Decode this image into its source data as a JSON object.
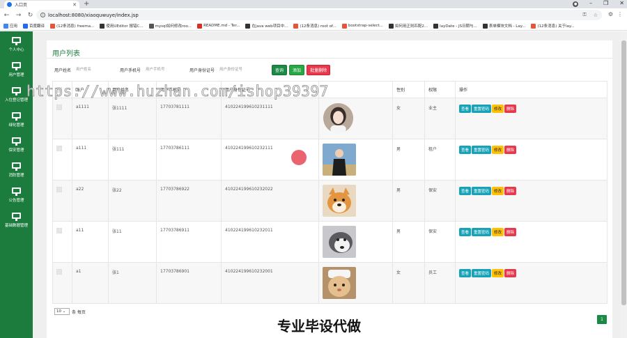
{
  "browser": {
    "tab_title": "入口页",
    "url": "localhost:8080/xiaoquwuye/index.jsp",
    "bookmarks": [
      {
        "label": "应用",
        "color": "#4285f4"
      },
      {
        "label": "百度翻译",
        "color": "#2468f2"
      },
      {
        "label": "(12条消息) freema...",
        "color": "#e8543a"
      },
      {
        "label": "使用UEditor 报错C...",
        "color": "#333333"
      },
      {
        "label": "mysql如何修改roo...",
        "color": "#555555"
      },
      {
        "label": "README.md - Ter...",
        "color": "#d93025"
      },
      {
        "label": "在java web项目中...",
        "color": "#333333"
      },
      {
        "label": "(12条消息) root of...",
        "color": "#e8543a"
      },
      {
        "label": "bootstrap-select...",
        "color": "#e8543a"
      },
      {
        "label": "如何用正则匹配2...",
        "color": "#333333"
      },
      {
        "label": "layDate - JS日期与...",
        "color": "#333333"
      },
      {
        "label": "表单模块文档 - Lay...",
        "color": "#333333"
      },
      {
        "label": "(12条消息) 关于lay...",
        "color": "#e8543a"
      }
    ]
  },
  "sidebar": {
    "items": [
      {
        "label": "个人中心"
      },
      {
        "label": "用户管理"
      },
      {
        "label": "入住登记管理"
      },
      {
        "label": "绿化管理"
      },
      {
        "label": "保安管理"
      },
      {
        "label": "消防管理"
      },
      {
        "label": "公告管理"
      },
      {
        "label": "基础数据管理"
      }
    ]
  },
  "page": {
    "title": "用户列表",
    "search": {
      "name_label": "用户姓名",
      "name_placeholder": "用户姓名",
      "phone_label": "用户手机号",
      "phone_placeholder": "用户手机号",
      "id_label": "用户身份证号",
      "id_placeholder": "用户身份证号",
      "btn_query": "查询",
      "btn_add": "添加",
      "btn_batch_delete": "批量删除"
    },
    "table": {
      "columns": [
        "",
        "账户",
        "用户姓名",
        "用户手机号",
        "用户身份证号",
        "",
        "性别",
        "权限",
        "操作"
      ],
      "rows": [
        {
          "account": "a1111",
          "name": "张1111",
          "phone": "17703781111",
          "idcard": "410224199610231111",
          "gender": "女",
          "role": "业主",
          "avatar": "girl"
        },
        {
          "account": "a111",
          "name": "张111",
          "phone": "17703786111",
          "idcard": "410224199610232111",
          "gender": "男",
          "role": "租户",
          "avatar": "boy"
        },
        {
          "account": "a22",
          "name": "张22",
          "phone": "17703786922",
          "idcard": "410224199610232022",
          "gender": "男",
          "role": "保安",
          "avatar": "shiba"
        },
        {
          "account": "a11",
          "name": "张11",
          "phone": "17703786911",
          "idcard": "410224199610232011",
          "gender": "男",
          "role": "保安",
          "avatar": "husky"
        },
        {
          "account": "a1",
          "name": "张1",
          "phone": "17703786901",
          "idcard": "410224199610232001",
          "gender": "女",
          "role": "员工",
          "avatar": "cat"
        }
      ],
      "actions": {
        "view": "查看",
        "reset": "重置密码",
        "edit": "修改",
        "delete": "删除"
      }
    },
    "pagination": {
      "page_size": "10",
      "per_page_label": "条 每页",
      "current_page": "1"
    }
  },
  "overlay": {
    "watermark": "https://www.huzhan.com/ishop39397",
    "caption": "专业毕设代做"
  }
}
